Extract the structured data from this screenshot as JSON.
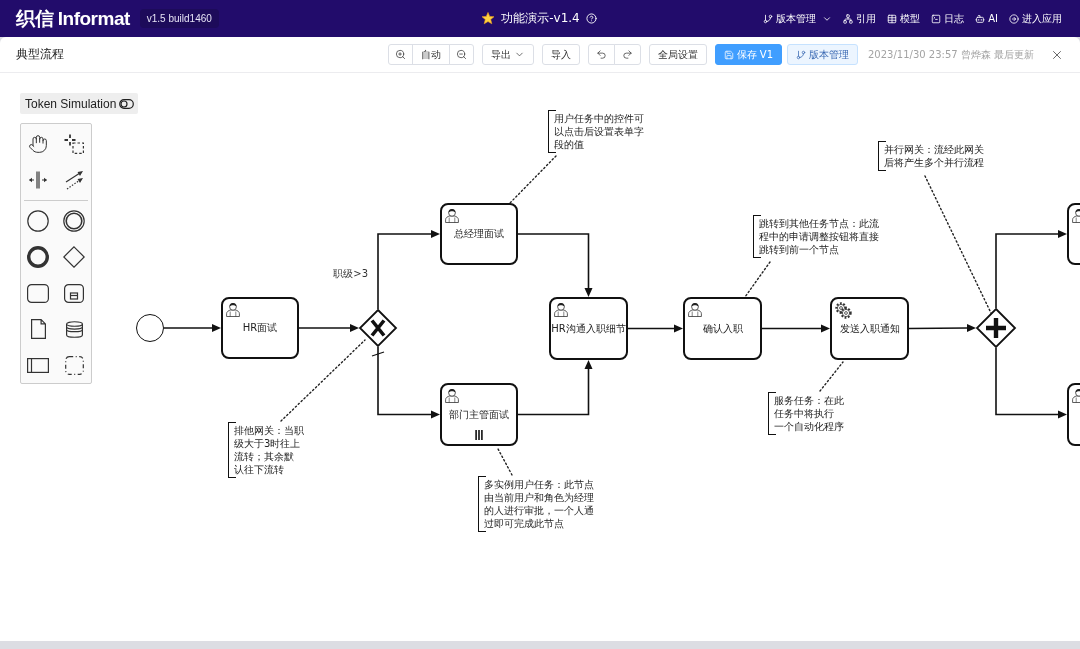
{
  "app_bar": {
    "logo": "织信 Informat",
    "version": "v1.5 build1460",
    "title": "功能演示-v1.4",
    "menu": [
      {
        "label": "版本管理",
        "dropdown": true
      },
      {
        "label": "引用",
        "dropdown": false
      },
      {
        "label": "模型",
        "dropdown": false
      },
      {
        "label": "日志",
        "dropdown": false
      },
      {
        "label": "AI",
        "dropdown": false
      },
      {
        "label": "进入应用",
        "dropdown": false
      }
    ]
  },
  "panel": {
    "title": "典型流程",
    "toolbar": [
      {
        "kind": "zoom",
        "label": "自动"
      },
      {
        "kind": "dropdown",
        "label": "导出"
      },
      {
        "kind": "plain",
        "label": "导入"
      },
      {
        "kind": "history"
      },
      {
        "kind": "plain",
        "label": "全局设置"
      },
      {
        "kind": "primary",
        "label": "保存 V1"
      },
      {
        "kind": "version",
        "label": "版本管理"
      }
    ],
    "updated": "2023/11/30 23:57 曾烨森 最后更新"
  },
  "token_simulation": {
    "label": "Token Simulation",
    "on": false
  },
  "diagram": {
    "nodes": [
      {
        "kind": "start_event"
      },
      {
        "kind": "user_task",
        "label": "HR面试",
        "multi_instance": false
      },
      {
        "kind": "exclusive_gateway"
      },
      {
        "kind": "user_task",
        "label": "总经理面试",
        "multi_instance": false
      },
      {
        "kind": "user_task",
        "label": "部门主管面试",
        "multi_instance": true
      },
      {
        "kind": "user_task",
        "label": "HR沟通入职细节",
        "multi_instance": false
      },
      {
        "kind": "user_task",
        "label": "确认入职",
        "multi_instance": false
      },
      {
        "kind": "service_task",
        "label": "发送入职通知",
        "multi_instance": false
      },
      {
        "kind": "parallel_gateway"
      },
      {
        "kind": "user_task"
      },
      {
        "kind": "user_task"
      }
    ],
    "flows": [
      {
        "default": false
      },
      {
        "default": false
      },
      {
        "label": "职级>3",
        "default": false
      },
      {
        "default": true
      },
      {
        "default": false
      },
      {
        "default": false
      },
      {
        "default": false
      },
      {
        "default": false
      },
      {
        "default": false
      },
      {
        "default": false
      },
      {
        "default": false
      }
    ],
    "annotations": [
      {
        "lines": [
          "用户任务中的控件可",
          "以点击后设置表单字",
          "段的值"
        ]
      },
      {
        "lines": [
          "并行网关：流经此网关",
          "后将产生多个并行流程"
        ]
      },
      {
        "lines": [
          "跳转到其他任务节点：此流",
          "程中的申请调整按钮将直接",
          "跳转到前一个节点"
        ]
      },
      {
        "lines": [
          "服务任务：在此",
          "任务中将执行",
          "一个自动化程序"
        ]
      },
      {
        "lines": [
          "排他网关：当职",
          "级大于3时往上",
          "流转；其余默",
          "认往下流转"
        ]
      },
      {
        "lines": [
          "多实例用户任务：此节点",
          "由当前用户和角色为经理",
          "的人进行审批，一个人通",
          "过即可完成此节点"
        ]
      }
    ]
  }
}
